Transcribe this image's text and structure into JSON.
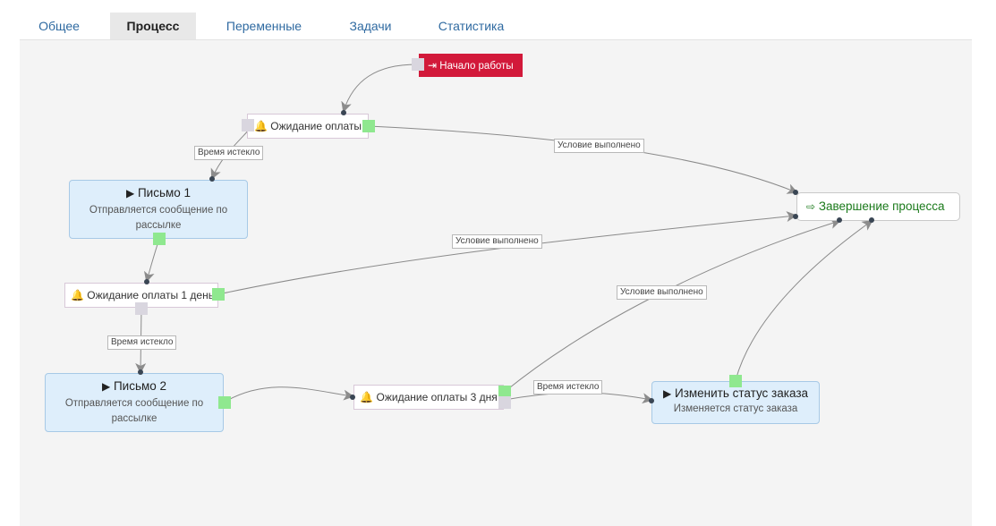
{
  "tabs": [
    {
      "label": "Общее"
    },
    {
      "label": "Процесс"
    },
    {
      "label": "Переменные"
    },
    {
      "label": "Задачи"
    },
    {
      "label": "Статистика"
    }
  ],
  "active_tab": "Процесс",
  "nodes": {
    "start": {
      "icon": "sign-in-icon",
      "label": "Начало работы",
      "color": "#d2193a"
    },
    "wait1": {
      "icon": "bell-icon",
      "label": "Ожидание оплаты"
    },
    "letter1": {
      "icon": "play-icon",
      "title": "Письмо 1",
      "description": "Отправляется сообщение по рассылке"
    },
    "wait2": {
      "icon": "bell-icon",
      "label": "Ожидание оплаты 1 день"
    },
    "letter2": {
      "icon": "play-icon",
      "title": "Письмо 2",
      "description": "Отправляется сообщение по рассылке"
    },
    "wait3": {
      "icon": "bell-icon",
      "label": "Ожидание оплаты 3 дня"
    },
    "status": {
      "icon": "play-icon",
      "title": "Изменить статус заказа",
      "description": "Изменяется статус заказа"
    },
    "end": {
      "icon": "sign-out-icon",
      "label": "Завершение процесса",
      "color": "#1b7a1b"
    }
  },
  "edge_labels": {
    "wait1_timeout": "Время истекло",
    "wait1_done": "Условие выполнено",
    "wait2_done": "Условие выполнено",
    "wait2_timeout": "Время истекло",
    "wait3_done": "Условие выполнено",
    "wait3_timeout": "Время истекло"
  },
  "colors": {
    "port_success": "#8fe88f",
    "port_timeout": "#d9d6df",
    "action_bg": "#deeefb",
    "accent": "#2f6aa1"
  }
}
